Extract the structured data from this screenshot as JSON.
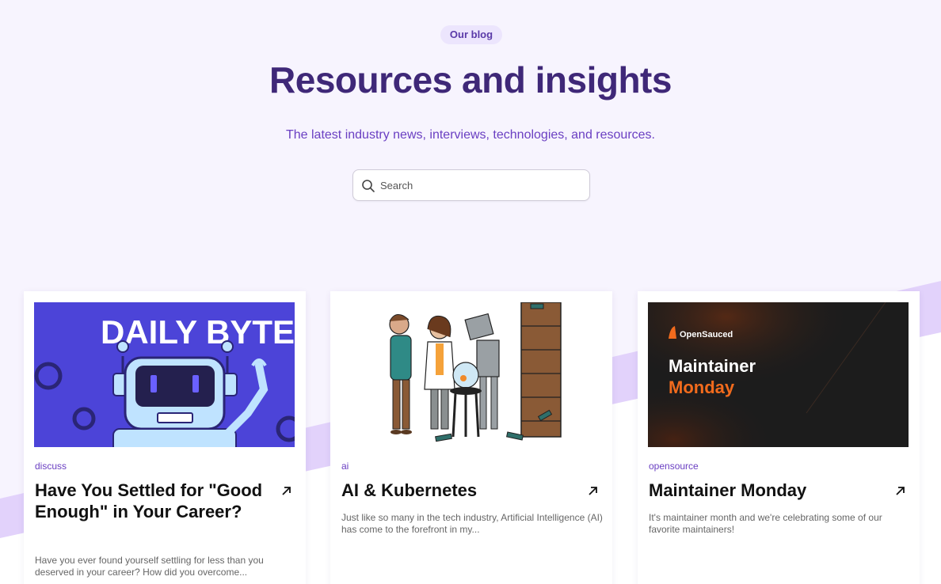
{
  "header": {
    "badge": "Our blog",
    "title": "Resources and insights",
    "subtitle": "The latest industry news, interviews, technologies, and resources."
  },
  "search": {
    "placeholder": "Search",
    "icon": "search-icon"
  },
  "colors": {
    "accent": "#6a3fc2",
    "title": "#3f2878",
    "badge_bg": "#ece5fd",
    "background": "#f7f4fe"
  },
  "posts": [
    {
      "tag": "discuss",
      "title": "Have You Settled for \"Good Enough\" in Your Career?",
      "excerpt": "Have you ever found yourself settling for less than you deserved in your career? How did you overcome...",
      "image_text": "DAILY BYTE"
    },
    {
      "tag": "ai",
      "title": "AI & Kubernetes",
      "excerpt": "Just like so many in the tech industry, Artificial Intelligence (AI) has come to the forefront in my..."
    },
    {
      "tag": "opensource",
      "title": "Maintainer Monday",
      "excerpt": "It's maintainer month and we're celebrating some of our favorite maintainers!",
      "image_brand": "OpenSauced",
      "image_line1": "Maintainer",
      "image_line2": "Monday"
    }
  ]
}
